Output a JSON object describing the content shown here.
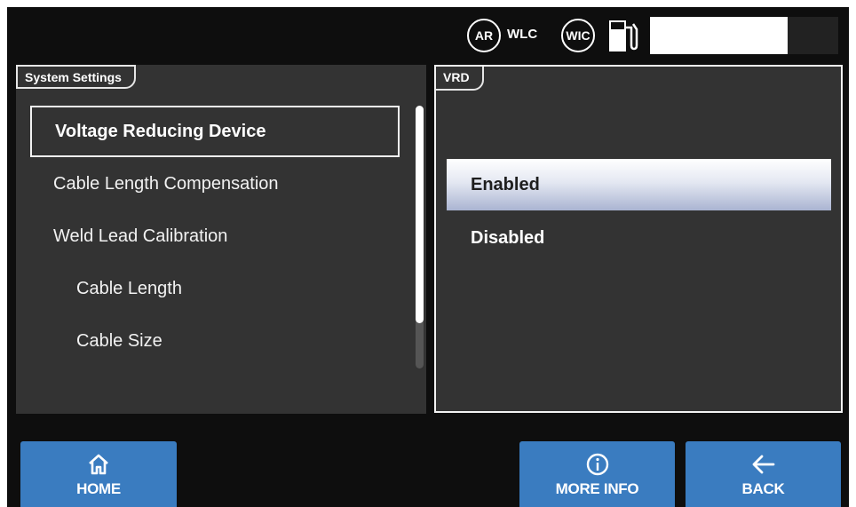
{
  "status_bar": {
    "badge_ar": "AR",
    "label_wlc": "WLC",
    "badge_wic": "WIC",
    "fuel_icon": "fuel-pump-icon",
    "meter_fraction": 0.73
  },
  "left_panel": {
    "title": "System Settings",
    "items": [
      {
        "label": "Voltage Reducing Device",
        "selected": true
      },
      {
        "label": "Cable Length Compensation"
      },
      {
        "label": "Weld Lead Calibration"
      },
      {
        "label": "Cable Length",
        "indent": true
      },
      {
        "label": "Cable Size",
        "indent": true
      }
    ]
  },
  "right_panel": {
    "title": "VRD",
    "options": [
      {
        "label": "Enabled",
        "selected": true
      },
      {
        "label": "Disabled"
      }
    ]
  },
  "buttons": {
    "home": {
      "label": "HOME",
      "icon": "home-icon"
    },
    "more_info": {
      "label": "MORE INFO",
      "icon": "info-icon"
    },
    "back": {
      "label": "BACK",
      "icon": "arrow-left-icon"
    }
  },
  "colors": {
    "background": "#0e0e0e",
    "panel": "#333333",
    "button_blue": "#3a7cc0"
  }
}
